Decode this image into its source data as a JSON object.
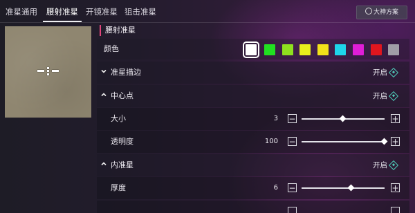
{
  "tabs": [
    {
      "label": "准星通用",
      "active": false
    },
    {
      "label": "腰射准星",
      "active": true
    },
    {
      "label": "开镜准星",
      "active": false
    },
    {
      "label": "狙击准星",
      "active": false
    }
  ],
  "scheme_button": {
    "label": "大神方案",
    "icon": "share-icon"
  },
  "section_title": "腰射准星",
  "color_row": {
    "label": "颜色",
    "swatches": [
      "#ffffff",
      "#21e021",
      "#8fe01e",
      "#e8f01c",
      "#f2e21a",
      "#1ed6ea",
      "#e01ed6",
      "#e0161e",
      "#a09ea6"
    ],
    "selected_index": 0
  },
  "outline_row": {
    "label": "准星描边",
    "state_text": "开启",
    "expanded": false
  },
  "center_dot": {
    "label": "中心点",
    "state_text": "开启",
    "expanded": true
  },
  "size_row": {
    "label": "大小",
    "value": "3",
    "slider_fraction": 0.5
  },
  "opacity_row": {
    "label": "透明度",
    "value": "100",
    "slider_fraction": 1.0
  },
  "inner_crosshair": {
    "label": "内准星",
    "state_text": "开启",
    "expanded": true
  },
  "thickness_row": {
    "label": "厚度",
    "value": "6",
    "slider_fraction": 0.6
  },
  "colors": {
    "accent": "#e0457a",
    "toggle_icon": "#4fc9b8"
  }
}
